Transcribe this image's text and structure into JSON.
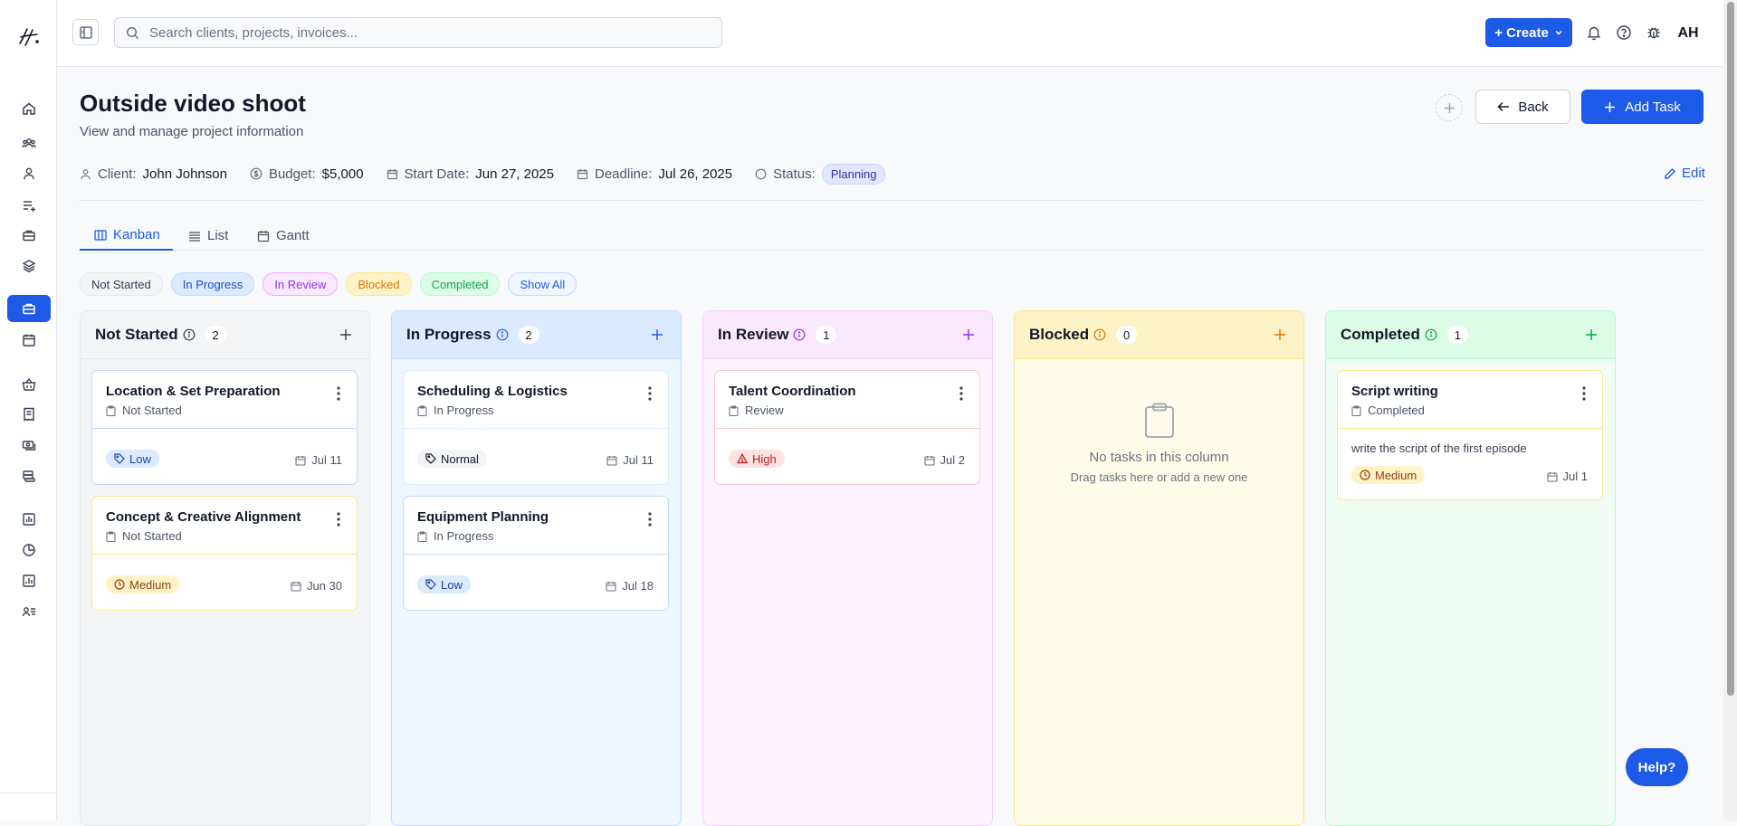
{
  "topbar": {
    "search_placeholder": "Search clients, projects, invoices...",
    "create_label": "+ Create",
    "avatar_initials": "AH"
  },
  "header": {
    "title": "Outside video shoot",
    "subtitle": "View and manage project information",
    "back_label": "Back",
    "add_task_label": "Add Task",
    "edit_label": "Edit"
  },
  "meta": {
    "client_label": "Client:",
    "client_value": "John Johnson",
    "budget_label": "Budget:",
    "budget_value": "$5,000",
    "start_label": "Start Date:",
    "start_value": "Jun 27, 2025",
    "deadline_label": "Deadline:",
    "deadline_value": "Jul 26, 2025",
    "status_label": "Status:",
    "status_value": "Planning"
  },
  "tabs": [
    {
      "label": "Kanban",
      "active": true
    },
    {
      "label": "List",
      "active": false
    },
    {
      "label": "Gantt",
      "active": false
    }
  ],
  "filters": [
    "Not Started",
    "In Progress",
    "In Review",
    "Blocked",
    "Completed",
    "Show All"
  ],
  "columns": [
    {
      "title": "Not Started",
      "count": "2",
      "cards": [
        {
          "title": "Location & Set Preparation",
          "status": "Not Started",
          "priority": "Low",
          "due": "Jul 11"
        },
        {
          "title": "Concept & Creative Alignment",
          "status": "Not Started",
          "priority": "Medium",
          "due": "Jun 30"
        }
      ]
    },
    {
      "title": "In Progress",
      "count": "2",
      "cards": [
        {
          "title": "Scheduling & Logistics",
          "status": "In Progress",
          "priority": "Normal",
          "due": "Jul 11"
        },
        {
          "title": "Equipment Planning",
          "status": "In Progress",
          "priority": "Low",
          "due": "Jul 18"
        }
      ]
    },
    {
      "title": "In Review",
      "count": "1",
      "cards": [
        {
          "title": "Talent Coordination",
          "status": "Review",
          "priority": "High",
          "due": "Jul 2"
        }
      ]
    },
    {
      "title": "Blocked",
      "count": "0",
      "empty_title": "No tasks in this column",
      "empty_sub": "Drag tasks here or add a new one",
      "cards": []
    },
    {
      "title": "Completed",
      "count": "1",
      "cards": [
        {
          "title": "Script writing",
          "status": "Completed",
          "description": "write the script of the first episode",
          "priority": "Medium",
          "due": "Jul 1"
        }
      ]
    }
  ],
  "help_label": "Help?",
  "colors": {
    "accent": "#1d5ae8",
    "not_started_bg": "#f3f4f6",
    "in_progress_bg": "#eff6ff",
    "in_review_bg": "#fdf4ff",
    "blocked_bg": "#fefce8",
    "completed_bg": "#f0fdf4"
  }
}
